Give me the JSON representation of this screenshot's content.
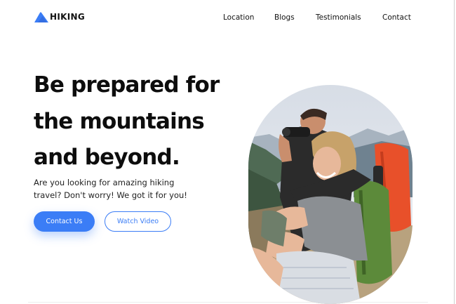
{
  "brand": {
    "name": "HIKING",
    "logo_icon": "mountain-icon",
    "accent": "#3b7df6"
  },
  "nav": {
    "items": [
      {
        "label": "Location"
      },
      {
        "label": "Blogs"
      },
      {
        "label": "Testimonials"
      },
      {
        "label": "Contact"
      }
    ]
  },
  "hero": {
    "headline": "Be prepared for the mountains and beyond.",
    "subtext": "Are you looking for amazing hiking travel? Don't worry! We got it for you!",
    "primary_button": "Contact Us",
    "secondary_button": "Watch Video",
    "image_description_icon": "hiking-couple-photo"
  }
}
